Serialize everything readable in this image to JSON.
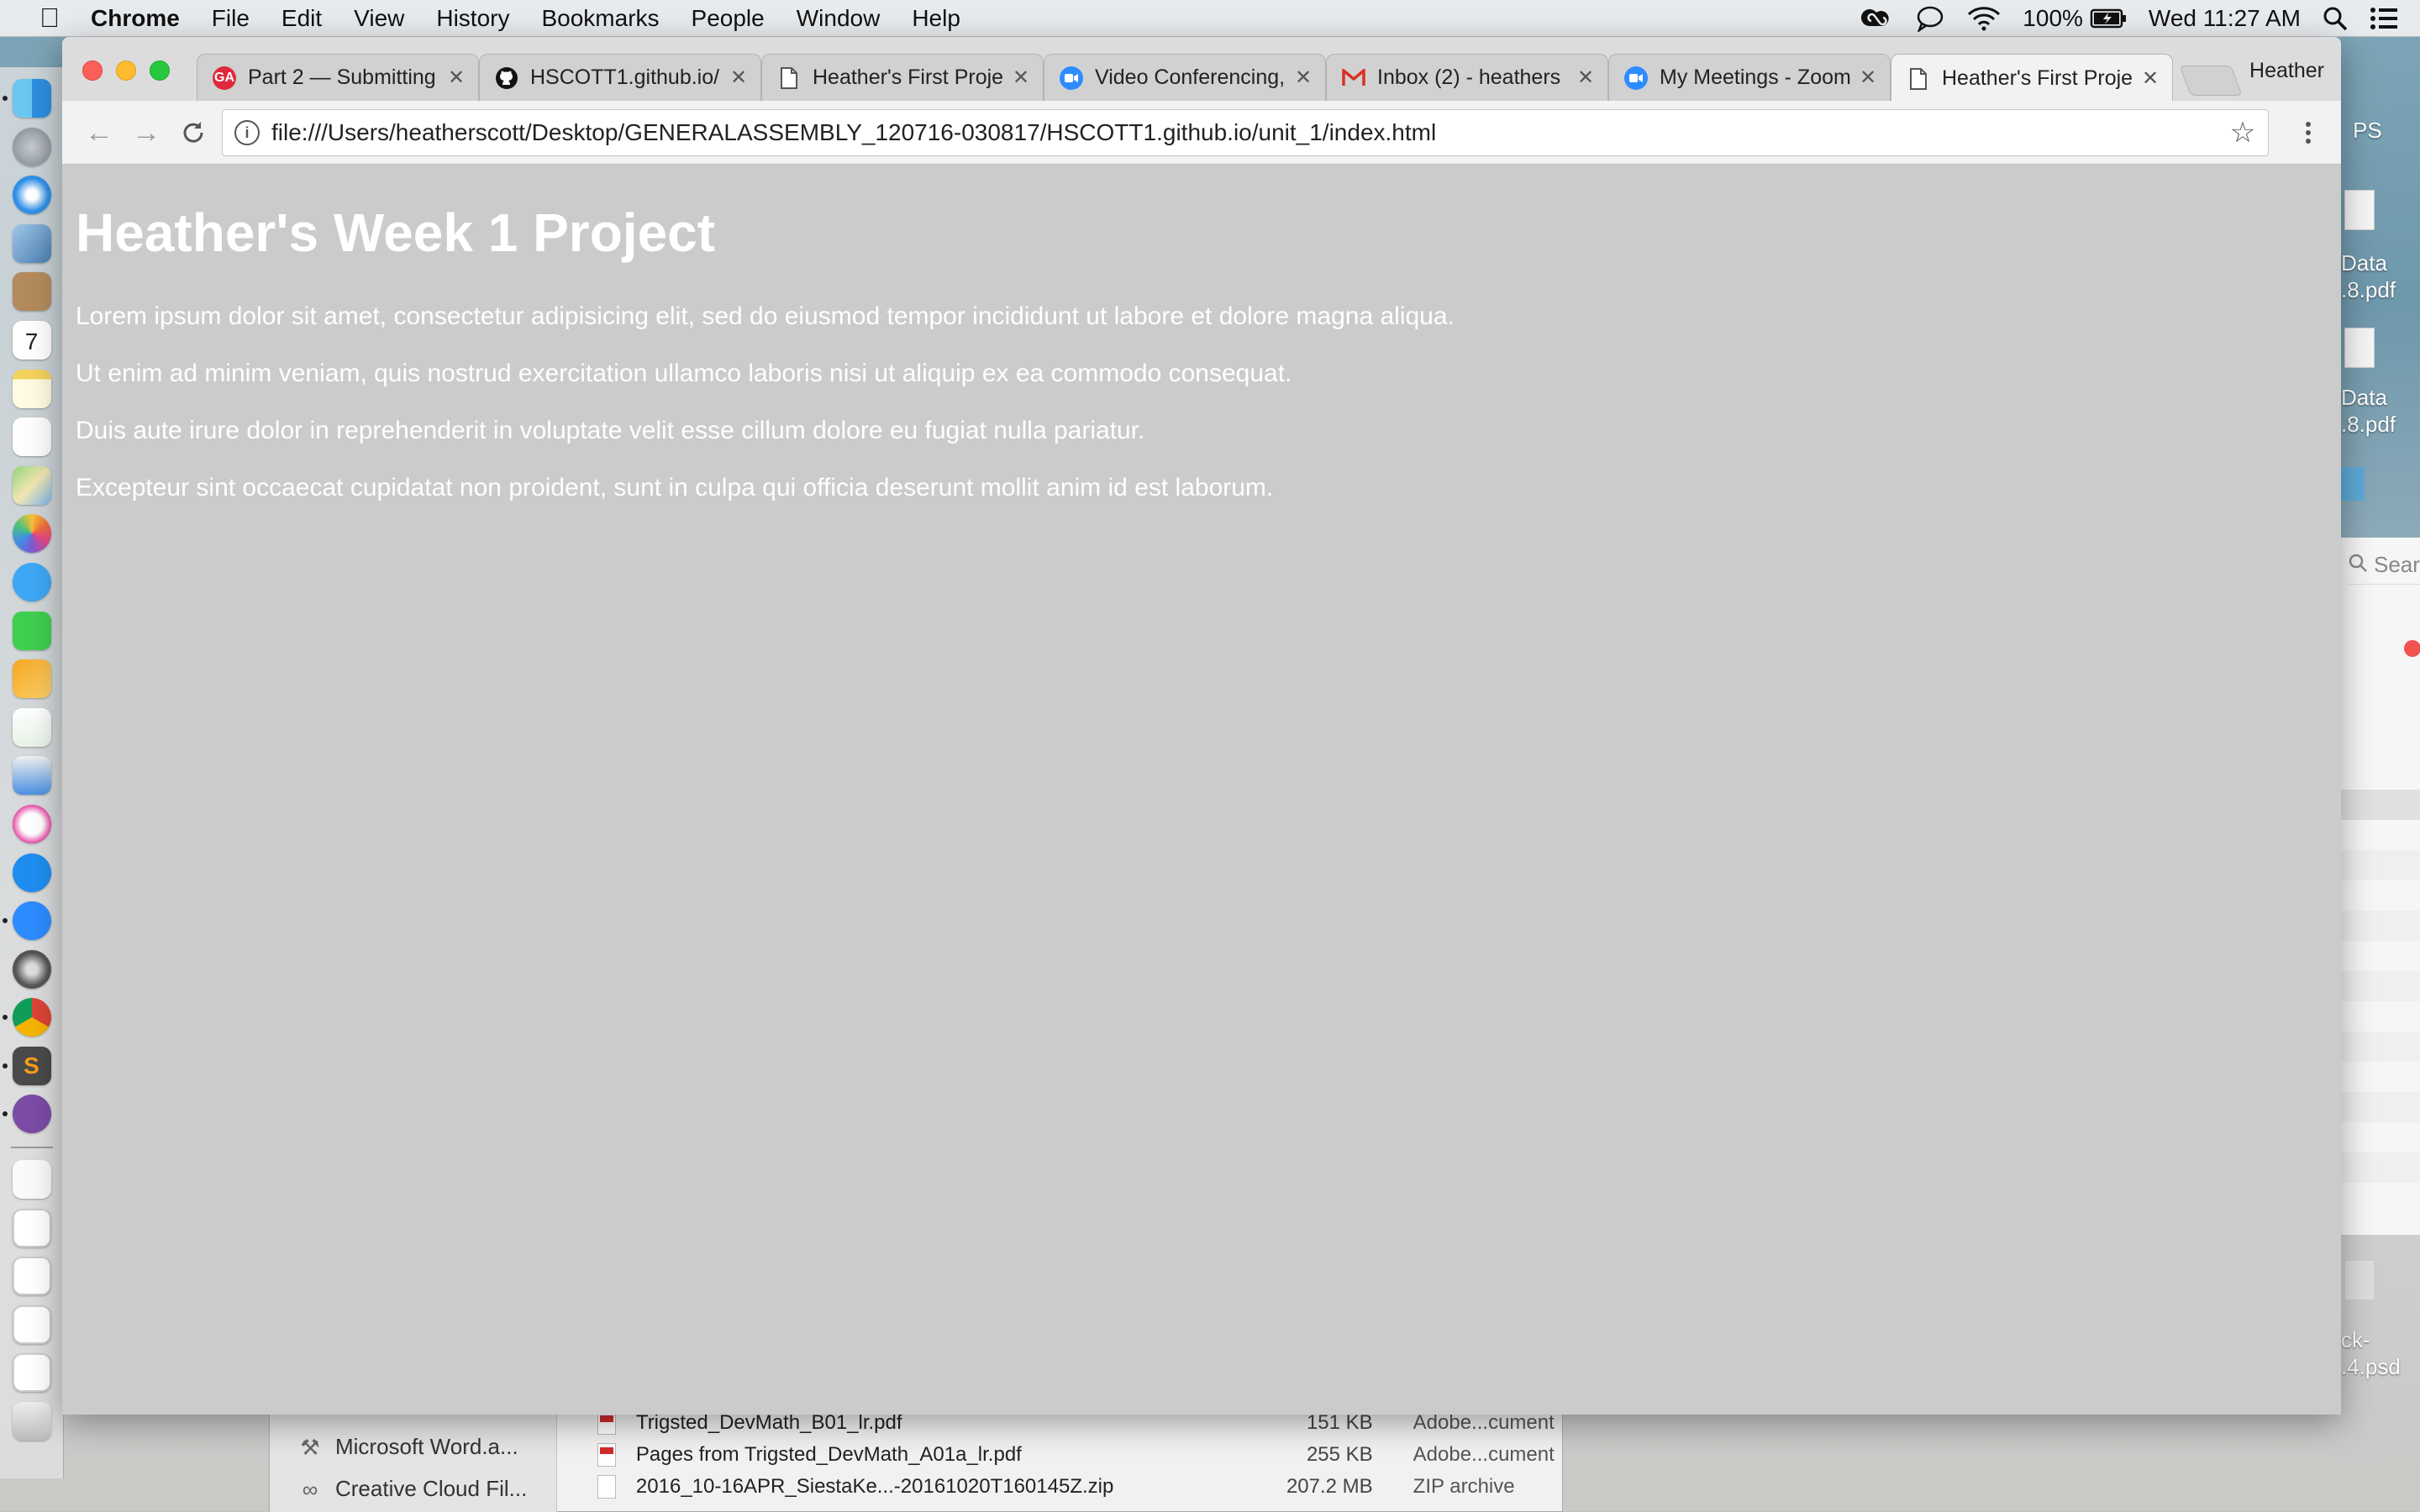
{
  "menubar": {
    "app_name": "Chrome",
    "items": [
      "File",
      "Edit",
      "View",
      "History",
      "Bookmarks",
      "People",
      "Window",
      "Help"
    ],
    "battery": "100%",
    "clock": "Wed 11:27 AM"
  },
  "browser": {
    "tabs": [
      {
        "title": "Part 2 — Submitting",
        "favicon": "ga-icon",
        "active": false
      },
      {
        "title": "HSCOTT1.github.io/",
        "favicon": "github-icon",
        "active": false
      },
      {
        "title": "Heather's First Proje",
        "favicon": "page-icon",
        "active": false
      },
      {
        "title": "Video Conferencing,",
        "favicon": "zoom-icon",
        "active": false
      },
      {
        "title": "Inbox (2) - heathers",
        "favicon": "gmail-icon",
        "active": false
      },
      {
        "title": "My Meetings - Zoom",
        "favicon": "zoom-icon",
        "active": false
      },
      {
        "title": "Heather's First Proje",
        "favicon": "page-icon",
        "active": true
      }
    ],
    "profile_name": "Heather",
    "url": "file:///Users/heatherscott/Desktop/GENERALASSEMBLY_120716-030817/HSCOTT1.github.io/unit_1/index.html"
  },
  "page": {
    "heading": "Heather's Week 1 Project",
    "paragraphs": [
      "Lorem ipsum dolor sit amet, consectetur adipisicing elit, sed do eiusmod tempor incididunt ut labore et dolore magna aliqua.",
      "Ut enim ad minim veniam, quis nostrud exercitation ullamco laboris nisi ut aliquip ex ea commodo consequat.",
      "Duis aute irure dolor in reprehenderit in voluptate velit esse cillum dolore eu fugiat nulla pariatur.",
      "Excepteur sint occaecat cupidatat non proident, sunt in culpa qui officia deserunt mollit anim id est laborum."
    ]
  },
  "finder": {
    "sidebar": [
      "Microsoft Word.a...",
      "Creative Cloud Fil..."
    ],
    "files": [
      {
        "name": "Trigsted_DevMath_B01_lr.pdf",
        "size": "151 KB",
        "kind": "Adobe...cument"
      },
      {
        "name": "Pages from Trigsted_DevMath_A01a_lr.pdf",
        "size": "255 KB",
        "kind": "Adobe...cument"
      },
      {
        "name": "2016_10-16APR_SiestaKe...-20161020T160145Z.zip",
        "size": "207.2 MB",
        "kind": "ZIP archive"
      }
    ]
  },
  "desktop": {
    "files": [
      "Data",
      ".8.pdf",
      "Data",
      ".8.pdf",
      "ck-",
      ".4.psd"
    ],
    "partial_label": "PS",
    "search_placeholder": "Sear"
  }
}
